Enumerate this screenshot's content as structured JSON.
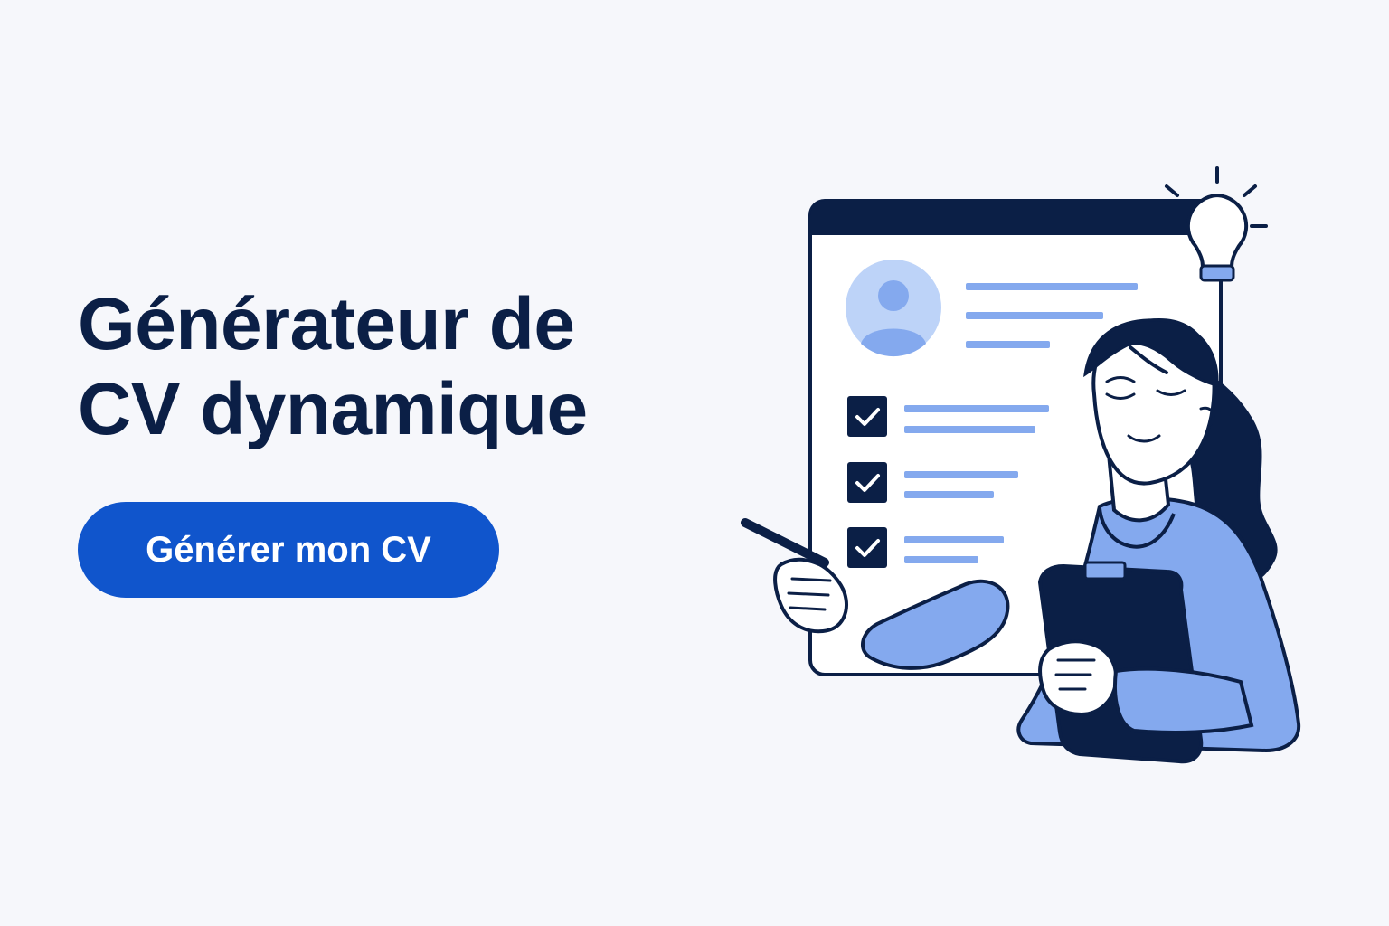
{
  "hero": {
    "title_line1": "Générateur de",
    "title_line2": "CV dynamique",
    "cta_label": "Générer mon CV"
  },
  "illustration": {
    "icons": [
      "resume-document-icon",
      "profile-avatar-icon",
      "checkbox-checked-icon",
      "lightbulb-icon",
      "woman-with-clipboard-illustration"
    ],
    "checklist_items": [
      {
        "checked": true
      },
      {
        "checked": true
      },
      {
        "checked": true
      }
    ]
  },
  "colors": {
    "background": "#F6F7FB",
    "title": "#0B1F46",
    "button": "#1055CC",
    "button_text": "#FFFFFF",
    "navy": "#0B1F46",
    "light_blue": "#84A9EE",
    "pale_blue": "#BDD3F8"
  }
}
